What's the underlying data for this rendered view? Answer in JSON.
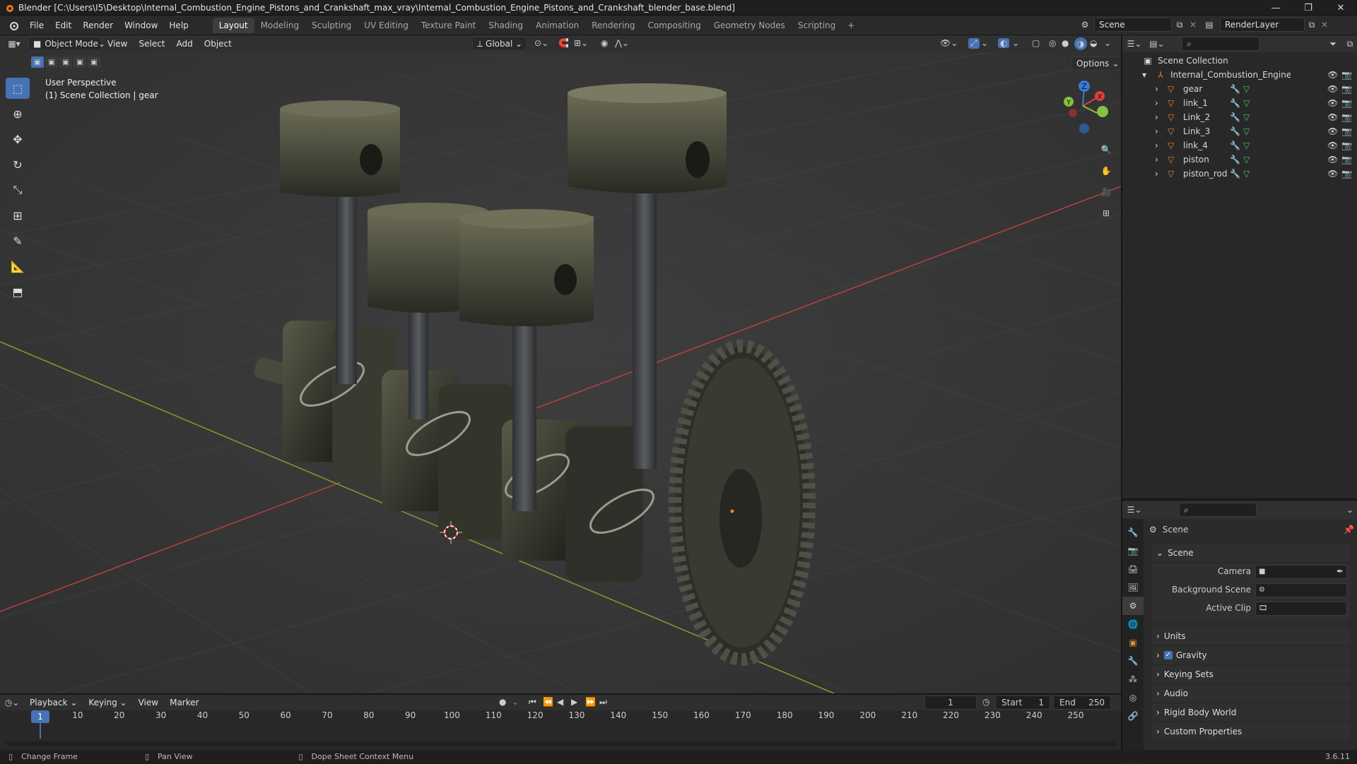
{
  "window": {
    "title": "Blender [C:\\Users\\I5\\Desktop\\Internal_Combustion_Engine_Pistons_and_Crankshaft_max_vray\\Internal_Combustion_Engine_Pistons_and_Crankshaft_blender_base.blend]"
  },
  "menu": {
    "items": [
      "File",
      "Edit",
      "Render",
      "Window",
      "Help"
    ],
    "workspaces": [
      "Layout",
      "Modeling",
      "Sculpting",
      "UV Editing",
      "Texture Paint",
      "Shading",
      "Animation",
      "Rendering",
      "Compositing",
      "Geometry Nodes",
      "Scripting"
    ],
    "active_workspace": "Layout",
    "scene_name": "Scene",
    "view_layer": "RenderLayer"
  },
  "viewport_header": {
    "mode": "Object Mode",
    "menus": [
      "View",
      "Select",
      "Add",
      "Object"
    ],
    "orientation": "Global",
    "options": "Options"
  },
  "viewport": {
    "perspective_label": "User Perspective",
    "context_label": "(1) Scene Collection | gear",
    "gizmo_axes": [
      "Z",
      "Y",
      "X"
    ]
  },
  "outliner": {
    "root": "Scene Collection",
    "collection": "Internal_Combustion_Engine_Pistons_an",
    "objects": [
      "gear",
      "link_1",
      "Link_2",
      "Link_3",
      "link_4",
      "piston",
      "piston_rod"
    ]
  },
  "properties": {
    "context": "Scene",
    "panel_scene": "Scene",
    "fields": [
      {
        "label": "Camera"
      },
      {
        "label": "Background Scene"
      },
      {
        "label": "Active Clip"
      }
    ],
    "sections": [
      "Units",
      "Gravity",
      "Keying Sets",
      "Audio",
      "Rigid Body World",
      "Custom Properties"
    ],
    "gravity_checked": true
  },
  "timeline": {
    "menus": [
      "Playback",
      "Keying",
      "View",
      "Marker"
    ],
    "current_frame": "1",
    "start_label": "Start",
    "start": "1",
    "end_label": "End",
    "end": "250",
    "ticks": [
      "1",
      "10",
      "20",
      "30",
      "40",
      "50",
      "60",
      "70",
      "80",
      "90",
      "100",
      "110",
      "120",
      "130",
      "140",
      "150",
      "160",
      "170",
      "180",
      "190",
      "200",
      "210",
      "220",
      "230",
      "240",
      "250"
    ]
  },
  "statusbar": {
    "items": [
      "Change Frame",
      "Pan View",
      "Dope Sheet Context Menu"
    ],
    "version": "3.6.11"
  },
  "colors": {
    "accent": "#4772b3",
    "x_axis": "#e04040",
    "y_axis": "#86c040",
    "z_axis": "#3c78d8",
    "object_orange": "#e08a3c"
  }
}
